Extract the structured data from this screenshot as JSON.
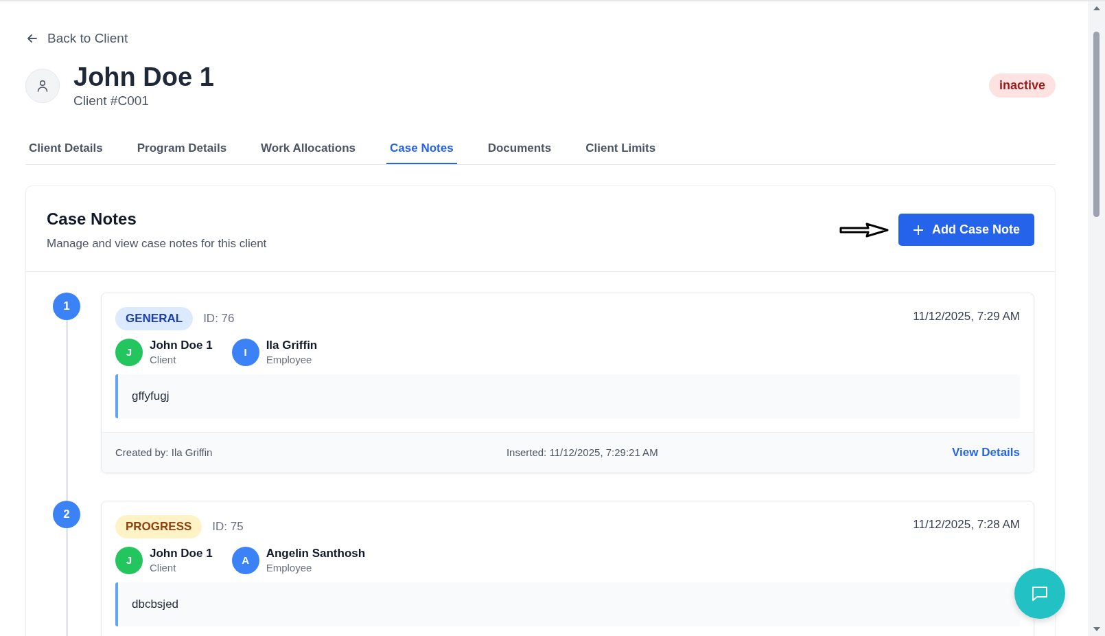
{
  "back_link": "Back to Client",
  "client": {
    "name": "John Doe 1",
    "number": "Client #C001",
    "status": "inactive"
  },
  "tabs": [
    {
      "label": "Client Details",
      "selected": false
    },
    {
      "label": "Program Details",
      "selected": false
    },
    {
      "label": "Work Allocations",
      "selected": false
    },
    {
      "label": "Case Notes",
      "selected": true
    },
    {
      "label": "Documents",
      "selected": false
    },
    {
      "label": "Client Limits",
      "selected": false
    }
  ],
  "case_notes": {
    "title": "Case Notes",
    "subtitle": "Manage and view case notes for this client",
    "add_button": "Add Case Note",
    "notes": [
      {
        "index": "1",
        "kind": "general",
        "category": "GENERAL",
        "id": "ID: 76",
        "timestamp": "11/12/2025, 7:29 AM",
        "participants": [
          {
            "initial": "J",
            "name": "John Doe 1",
            "role": "Client",
            "color": "#22c55e"
          },
          {
            "initial": "I",
            "name": "Ila Griffin",
            "role": "Employee",
            "color": "#3b82f6"
          }
        ],
        "text": "gffyfugj",
        "created_by": "Created by: Ila Griffin",
        "inserted": "Inserted: 11/12/2025, 7:29:21 AM",
        "view_details": "View Details"
      },
      {
        "index": "2",
        "kind": "progress",
        "category": "PROGRESS",
        "id": "ID: 75",
        "timestamp": "11/12/2025, 7:28 AM",
        "participants": [
          {
            "initial": "J",
            "name": "John Doe 1",
            "role": "Client",
            "color": "#22c55e"
          },
          {
            "initial": "A",
            "name": "Angelin Santhosh",
            "role": "Employee",
            "color": "#3b82f6"
          }
        ],
        "text": "dbcbsjed"
      }
    ]
  }
}
